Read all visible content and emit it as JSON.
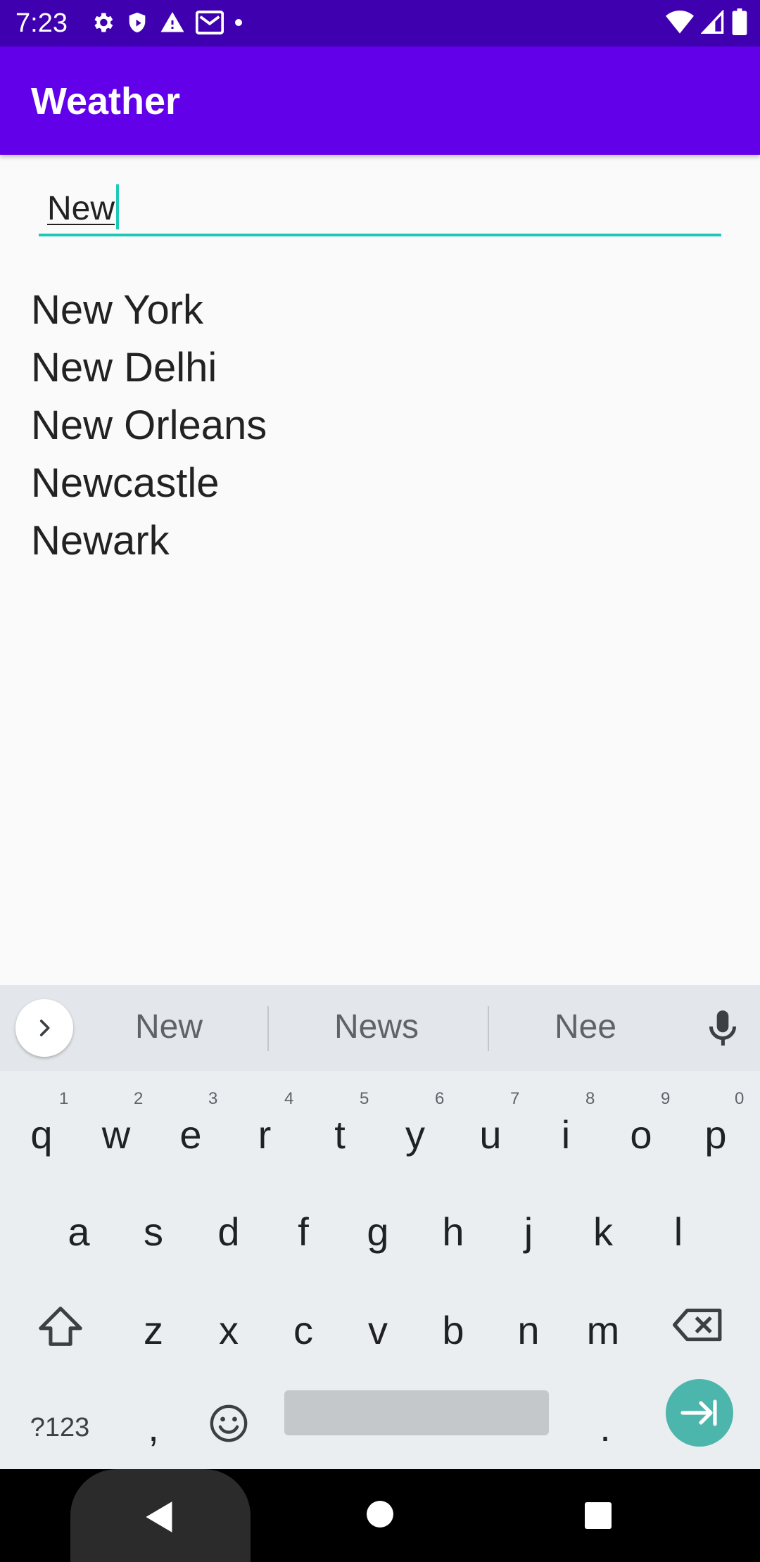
{
  "status": {
    "time": "7:23",
    "left_icons": [
      "settings-icon",
      "shield-icon",
      "warning-icon",
      "gmail-icon",
      "dot-icon"
    ],
    "right_icons": [
      "wifi-icon",
      "signal-icon",
      "battery-icon"
    ]
  },
  "appbar": {
    "title": "Weather",
    "color": "#6200ea"
  },
  "search": {
    "value": "New",
    "accent": "#1ec9b8"
  },
  "results": [
    "New York",
    "New Delhi",
    "New Orleans",
    "Newcastle",
    "Newark"
  ],
  "keyboard": {
    "suggestions": [
      "New",
      "News",
      "Nee"
    ],
    "row1": [
      "q",
      "w",
      "e",
      "r",
      "t",
      "y",
      "u",
      "i",
      "o",
      "p"
    ],
    "row1_hints": [
      "1",
      "2",
      "3",
      "4",
      "5",
      "6",
      "7",
      "8",
      "9",
      "0"
    ],
    "row2": [
      "a",
      "s",
      "d",
      "f",
      "g",
      "h",
      "j",
      "k",
      "l"
    ],
    "row3": [
      "z",
      "x",
      "c",
      "v",
      "b",
      "n",
      "m"
    ],
    "symbols_label": "?123",
    "comma": ",",
    "period": ".",
    "enter_color": "#4db6ac"
  },
  "nav": {
    "buttons": [
      "back-icon",
      "home-icon",
      "recents-icon"
    ]
  }
}
